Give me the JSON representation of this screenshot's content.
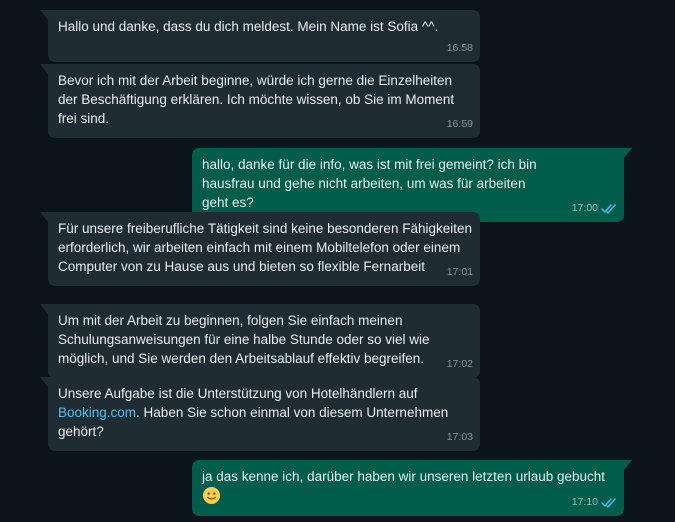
{
  "colors": {
    "background": "#0b141a",
    "incoming_bubble": "#202c33",
    "outgoing_bubble": "#005c4b",
    "text": "#e9edef",
    "timestamp": "#8696a0",
    "read_ticks": "#53bdeb",
    "link": "#53bdeb"
  },
  "messages": [
    {
      "direction": "incoming",
      "text": "Hallo und danke, dass du dich meldest. Mein Name ist Sofia ^^.",
      "time": "16:58"
    },
    {
      "direction": "incoming",
      "text": "Bevor ich mit der Arbeit beginne, würde ich gerne die Einzelheiten der Beschäftigung erklären. Ich möchte wissen, ob Sie im Moment frei sind.",
      "time": "16:59"
    },
    {
      "direction": "outgoing",
      "text": "hallo, danke für die info, was ist mit frei gemeint? ich bin hausfrau und gehe nicht arbeiten, um was für arbeiten geht es?",
      "time": "17:00",
      "status_icon": "double-check-read-icon"
    },
    {
      "direction": "incoming",
      "text": "Für unsere freiberufliche Tätigkeit sind keine besonderen Fähigkeiten erforderlich, wir arbeiten einfach mit einem Mobiltelefon oder einem Computer von zu Hause aus und bieten so flexible Fernarbeit",
      "time": "17:01"
    },
    {
      "direction": "incoming",
      "text": "Um mit der Arbeit zu beginnen, folgen Sie einfach meinen Schulungsanweisungen für eine halbe Stunde oder so viel wie möglich, und Sie werden den Arbeitsablauf effektiv begreifen.",
      "time": "17:02"
    },
    {
      "direction": "incoming",
      "text_before_link": "Unsere Aufgabe ist die Unterstützung von Hotelhändlern auf",
      "link_text": "Booking.com",
      "text_after_link": ". Haben Sie schon einmal von diesem Unternehmen gehört?",
      "time": "17:03"
    },
    {
      "direction": "outgoing",
      "text": "ja das kenne ich, darüber haben wir unseren letzten urlaub gebucht",
      "emoji": "slightly-smiling-face-icon",
      "time": "17:10",
      "status_icon": "double-check-read-icon"
    }
  ]
}
